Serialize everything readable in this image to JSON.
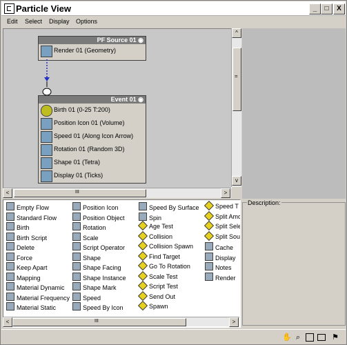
{
  "window": {
    "title": "Particle View"
  },
  "title_buttons": {
    "minimize": "_",
    "maximize": "□",
    "close": "X"
  },
  "menu": [
    "Edit",
    "Select",
    "Display",
    "Options"
  ],
  "nodes": {
    "pf_source": {
      "header": "PF Source 01",
      "ops": [
        {
          "label": "Render 01 (Geometry)",
          "icon": "render-icon"
        }
      ]
    },
    "event": {
      "header": "Event 01",
      "ops": [
        {
          "label": "Birth 01 (0-25 T:200)",
          "icon": "birth-icon"
        },
        {
          "label": "Position Icon 01 (Volume)",
          "icon": "position-icon"
        },
        {
          "label": "Speed 01 (Along Icon Arrow)",
          "icon": "speed-icon"
        },
        {
          "label": "Rotation 01 (Random 3D)",
          "icon": "rotation-icon"
        },
        {
          "label": "Shape 01 (Tetra)",
          "icon": "shape-icon"
        },
        {
          "label": "Display 01 (Ticks)",
          "icon": "display-icon"
        }
      ]
    }
  },
  "depot": {
    "col1": [
      "Empty Flow",
      "Standard Flow",
      "Birth",
      "Birth Script",
      "Delete",
      "Force",
      "Keep Apart",
      "Mapping",
      "Material Dynamic",
      "Material Frequency",
      "Material Static"
    ],
    "col2": [
      "Position Icon",
      "Position Object",
      "Rotation",
      "Scale",
      "Script Operator",
      "Shape",
      "Shape Facing",
      "Shape Instance",
      "Shape Mark",
      "Speed",
      "Speed By Icon"
    ],
    "col3": [
      "Speed By Surface",
      "Spin",
      "Age Test",
      "Collision",
      "Collision Spawn",
      "Find Target",
      "Go To Rotation",
      "Scale Test",
      "Script Test",
      "Send Out",
      "Spawn"
    ],
    "col4": [
      "Speed T",
      "Split Amo",
      "Split Sele",
      "Split Sou",
      "Cache",
      "Display",
      "Notes",
      "Render"
    ]
  },
  "description": {
    "label": "Description:"
  },
  "scroll": {
    "left": "<",
    "right": ">",
    "up": "^",
    "down": "v",
    "grip": "III",
    "vgrip": "="
  },
  "status_icons": [
    "pan-icon",
    "zoom-icon",
    "zoom-region-icon",
    "zoom-extents-icon",
    "no-icon"
  ]
}
